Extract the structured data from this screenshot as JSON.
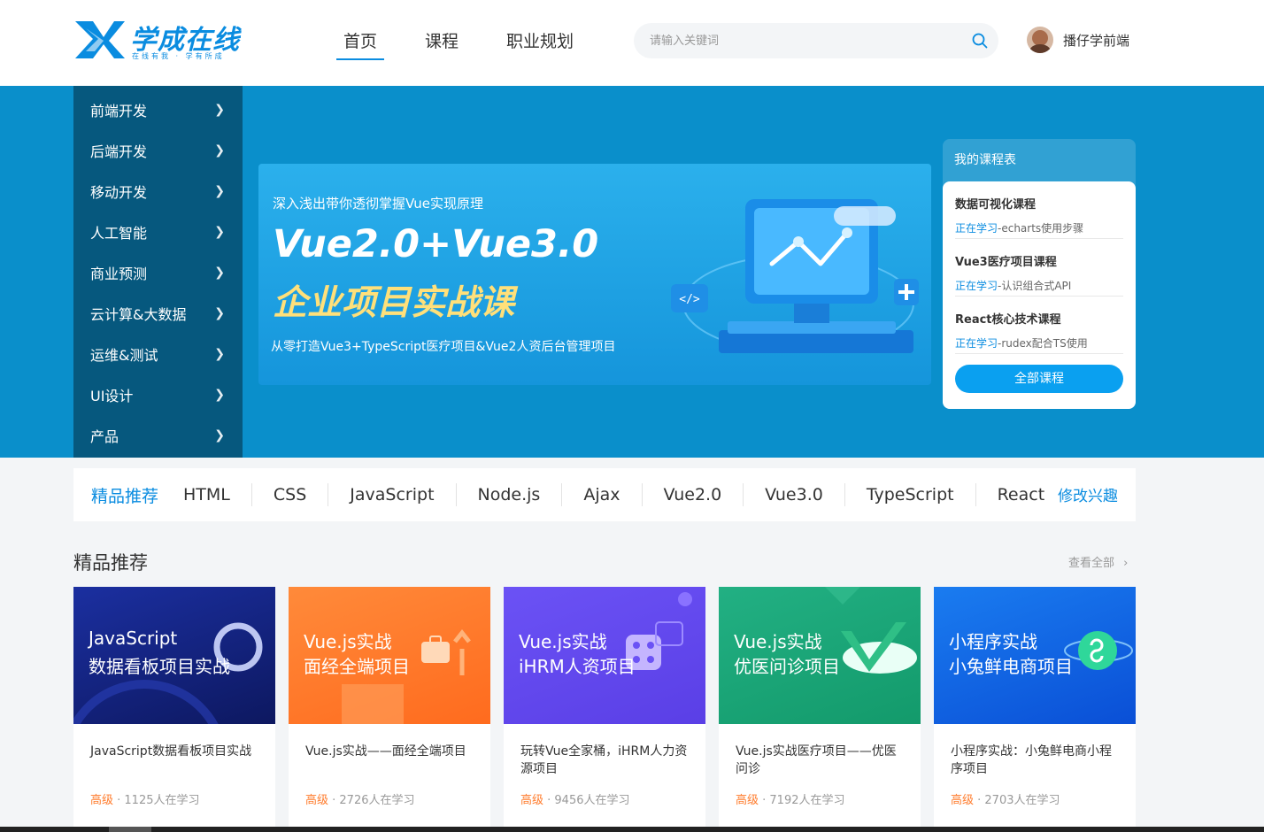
{
  "header": {
    "logo_text": "学成在线",
    "logo_slogan": "在线有我 · 学有所成",
    "nav": [
      "首页",
      "课程",
      "职业规划"
    ],
    "search_placeholder": "请输入关键词",
    "username": "播仔学前端"
  },
  "sidebar": {
    "items": [
      "前端开发",
      "后端开发",
      "移动开发",
      "人工智能",
      "商业预测",
      "云计算&大数据",
      "运维&测试",
      "UI设计",
      "产品"
    ]
  },
  "banner": {
    "subtitle": "深入浅出带你透彻掌握Vue实现原理",
    "title1": "Vue2.0+Vue3.0",
    "title2": "企业项目实战课",
    "desc": "从零打造Vue3+TypeScript医疗项目&Vue2人资后台管理项目"
  },
  "schedule": {
    "title": "我的课程表",
    "items": [
      {
        "name": "数据可视化课程",
        "status": "正在学习",
        "lesson": "-echarts使用步骤"
      },
      {
        "name": "Vue3医疗项目课程",
        "status": "正在学习",
        "lesson": "-认识组合式API"
      },
      {
        "name": "React核心技术课程",
        "status": "正在学习",
        "lesson": "-rudex配合TS使用"
      }
    ],
    "button": "全部课程"
  },
  "tags": {
    "title": "精品推荐",
    "items": [
      "HTML",
      "CSS",
      "JavaScript",
      "Node.js",
      "Ajax",
      "Vue2.0",
      "Vue3.0",
      "TypeScript",
      "React"
    ],
    "edit": "修改兴趣"
  },
  "section": {
    "title": "精品推荐",
    "more": "查看全部"
  },
  "cards": [
    {
      "cover1": "JavaScript",
      "cover2": "数据看板项目实战",
      "title": "JavaScript数据看板项目实战",
      "level": "高级",
      "count": " · 1125人在学习",
      "color": "#1a2a8c"
    },
    {
      "cover1": "Vue.js实战",
      "cover2": "面经全端项目",
      "title": "Vue.js实战——面经全端项目",
      "level": "高级",
      "count": " · 2726人在学习",
      "color": "#ff7a2e"
    },
    {
      "cover1": "Vue.js实战",
      "cover2": "iHRM人资项目",
      "title": "玩转Vue全家桶，iHRM人力资源项目",
      "level": "高级",
      "count": " · 9456人在学习",
      "color": "#6a4ff0"
    },
    {
      "cover1": "Vue.js实战",
      "cover2": "优医问诊项目",
      "title": "Vue.js实战医疗项目——优医问诊",
      "level": "高级",
      "count": " · 7192人在学习",
      "color": "#1aa678"
    },
    {
      "cover1": "小程序实战",
      "cover2": "小兔鲜电商项目",
      "title": "小程序实战：小兔鲜电商小程序项目",
      "level": "高级",
      "count": " · 2703人在学习",
      "color": "#0e63e8"
    }
  ]
}
